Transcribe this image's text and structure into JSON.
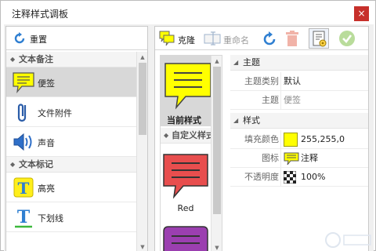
{
  "window": {
    "title": "注释样式调板",
    "close": "×"
  },
  "left_toolbar": {
    "reset_label": "重置"
  },
  "left_list": [
    {
      "type": "group",
      "label": "文本备注"
    },
    {
      "type": "item",
      "label": "便签",
      "icon": "sticky-note-icon",
      "selected": true
    },
    {
      "type": "item",
      "label": "文件附件",
      "icon": "paperclip-icon"
    },
    {
      "type": "item",
      "label": "声音",
      "icon": "speaker-icon"
    },
    {
      "type": "group",
      "label": "文本标记"
    },
    {
      "type": "item",
      "label": "高亮",
      "icon": "highlight-icon"
    },
    {
      "type": "item",
      "label": "下划线",
      "icon": "underline-icon"
    }
  ],
  "right_toolbar": {
    "clone_label": "克隆",
    "rename_label": "重命名"
  },
  "styles": {
    "current_label": "当前样式",
    "custom_group": "自定义样式",
    "red_label": "Red"
  },
  "props": {
    "section_theme": "主题",
    "theme_category_key": "主题类别",
    "theme_category_val": "默认",
    "theme_key": "主题",
    "theme_val": "便签",
    "section_style": "样式",
    "fill_key": "填充颜色",
    "fill_val": "255,255,0",
    "icon_key": "图标",
    "icon_val": "注释",
    "opacity_key": "不透明度",
    "opacity_val": "100%"
  },
  "colors": {
    "note_yellow": "#ffff00",
    "note_red": "#e84e4e",
    "note_purple": "#9b3fb0",
    "close_red": "#c7302b",
    "accent_blue": "#2f7fd1"
  }
}
